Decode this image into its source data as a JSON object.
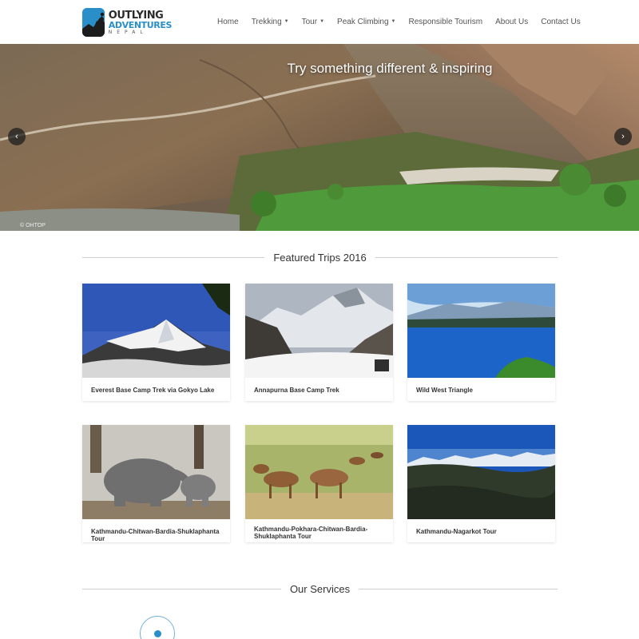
{
  "brand": {
    "line1": "OUTLYING",
    "line2": "ADVENTURES",
    "line3": "NEPAL"
  },
  "nav": {
    "items": [
      {
        "label": "Home",
        "dropdown": false
      },
      {
        "label": "Trekking",
        "dropdown": true
      },
      {
        "label": "Tour",
        "dropdown": true
      },
      {
        "label": "Peak Climbing",
        "dropdown": true
      },
      {
        "label": "Responsible Tourism",
        "dropdown": false
      },
      {
        "label": "About Us",
        "dropdown": false
      },
      {
        "label": "Contact Us",
        "dropdown": false
      }
    ]
  },
  "hero": {
    "title": "Try something different & inspiring",
    "credit": "© OHTOP",
    "prev_icon": "‹",
    "next_icon": "›"
  },
  "featured": {
    "heading": "Featured Trips 2016",
    "trips": [
      {
        "title": "Everest Base Camp Trek via Gokyo Lake"
      },
      {
        "title": "Annapurna Base Camp Trek"
      },
      {
        "title": "Wild West Triangle"
      },
      {
        "title": "Kathmandu-Chitwan-Bardia-Shuklaphanta Tour"
      },
      {
        "title": "Kathmandu-Pokhara-Chitwan-Bardia-Shuklaphanta Tour"
      },
      {
        "title": "Kathmandu-Nagarkot Tour"
      }
    ]
  },
  "services": {
    "heading": "Our Services"
  },
  "colors": {
    "accent": "#2a8fc9",
    "divider": "#cfcfcf"
  }
}
